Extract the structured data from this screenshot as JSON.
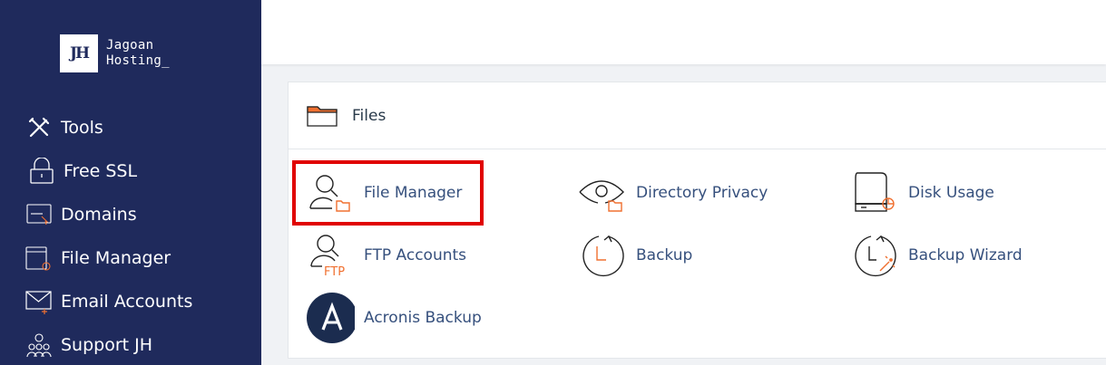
{
  "brand": {
    "logo_text": "JH",
    "name_line1": "Jagoan",
    "name_line2": "Hosting_"
  },
  "sidebar": {
    "items": [
      {
        "label": "Tools",
        "icon": "tools-icon"
      },
      {
        "label": "Free SSL",
        "icon": "lock-icon"
      },
      {
        "label": "Domains",
        "icon": "domain-icon"
      },
      {
        "label": "File Manager",
        "icon": "file-manager-icon"
      },
      {
        "label": "Email Accounts",
        "icon": "email-icon"
      },
      {
        "label": "Support JH",
        "icon": "support-icon"
      }
    ]
  },
  "files_panel": {
    "title": "Files",
    "tools": [
      {
        "label": "File Manager",
        "icon": "file-manager-icon"
      },
      {
        "label": "Directory Privacy",
        "icon": "directory-privacy-icon"
      },
      {
        "label": "Disk Usage",
        "icon": "disk-usage-icon"
      },
      {
        "label": "FTP Accounts",
        "icon": "ftp-accounts-icon",
        "icon_text": "FTP"
      },
      {
        "label": "Backup",
        "icon": "backup-icon"
      },
      {
        "label": "Backup Wizard",
        "icon": "backup-wizard-icon"
      },
      {
        "label": "Acronis Backup",
        "icon": "acronis-icon"
      }
    ]
  },
  "colors": {
    "sidebar_bg": "#1f2a5c",
    "accent_orange": "#f07030",
    "link_blue": "#36507d",
    "highlight_red": "#e00000"
  }
}
